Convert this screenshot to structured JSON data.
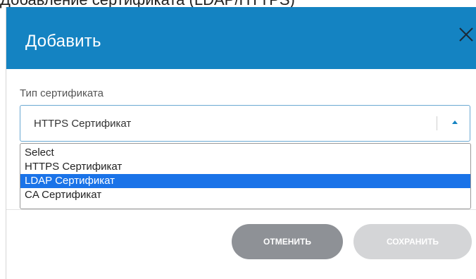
{
  "background_text": "Добавление сертификата (LDAP/HTTPS)",
  "dialog": {
    "title": "Добавить",
    "close_icon": "close-icon",
    "header_color": "#1483c2"
  },
  "form": {
    "certificate_type_label": "Тип сертификата",
    "certificate_type_value": "HTTPS Сертификат",
    "options": [
      "Select",
      "HTTPS Сертификат",
      "LDAP Сертификат",
      "CA Сертификат"
    ],
    "highlighted_option": "LDAP Сертификат"
  },
  "buttons": {
    "cancel_label": "ОТМЕНИТЬ",
    "save_label": "СОХРАНИТЬ"
  }
}
